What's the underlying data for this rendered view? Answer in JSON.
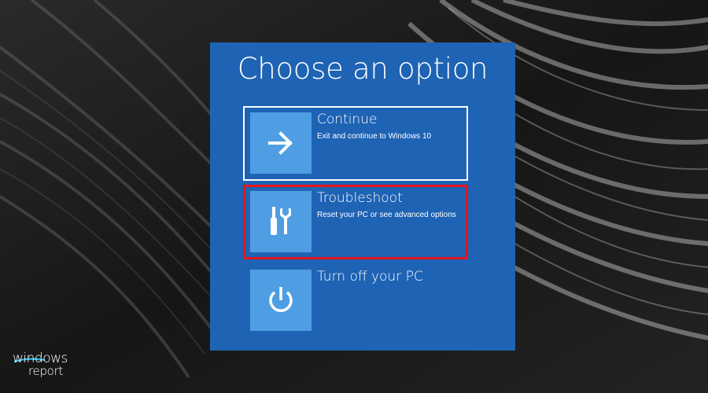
{
  "screen": {
    "title": "Choose an option"
  },
  "options": [
    {
      "label": "Continue",
      "description": "Exit and continue to Windows 10",
      "icon": "arrow-right-icon"
    },
    {
      "label": "Troubleshoot",
      "description": "Reset your PC or see advanced options",
      "icon": "tools-icon"
    },
    {
      "label": "Turn off your PC",
      "description": "",
      "icon": "power-icon"
    }
  ],
  "watermark": {
    "line1": "windows",
    "line2": "report"
  },
  "colors": {
    "panel": "#1e63b4",
    "tile": "#4f9ee3",
    "highlight": "#e8141a",
    "text": "#ffffff"
  }
}
